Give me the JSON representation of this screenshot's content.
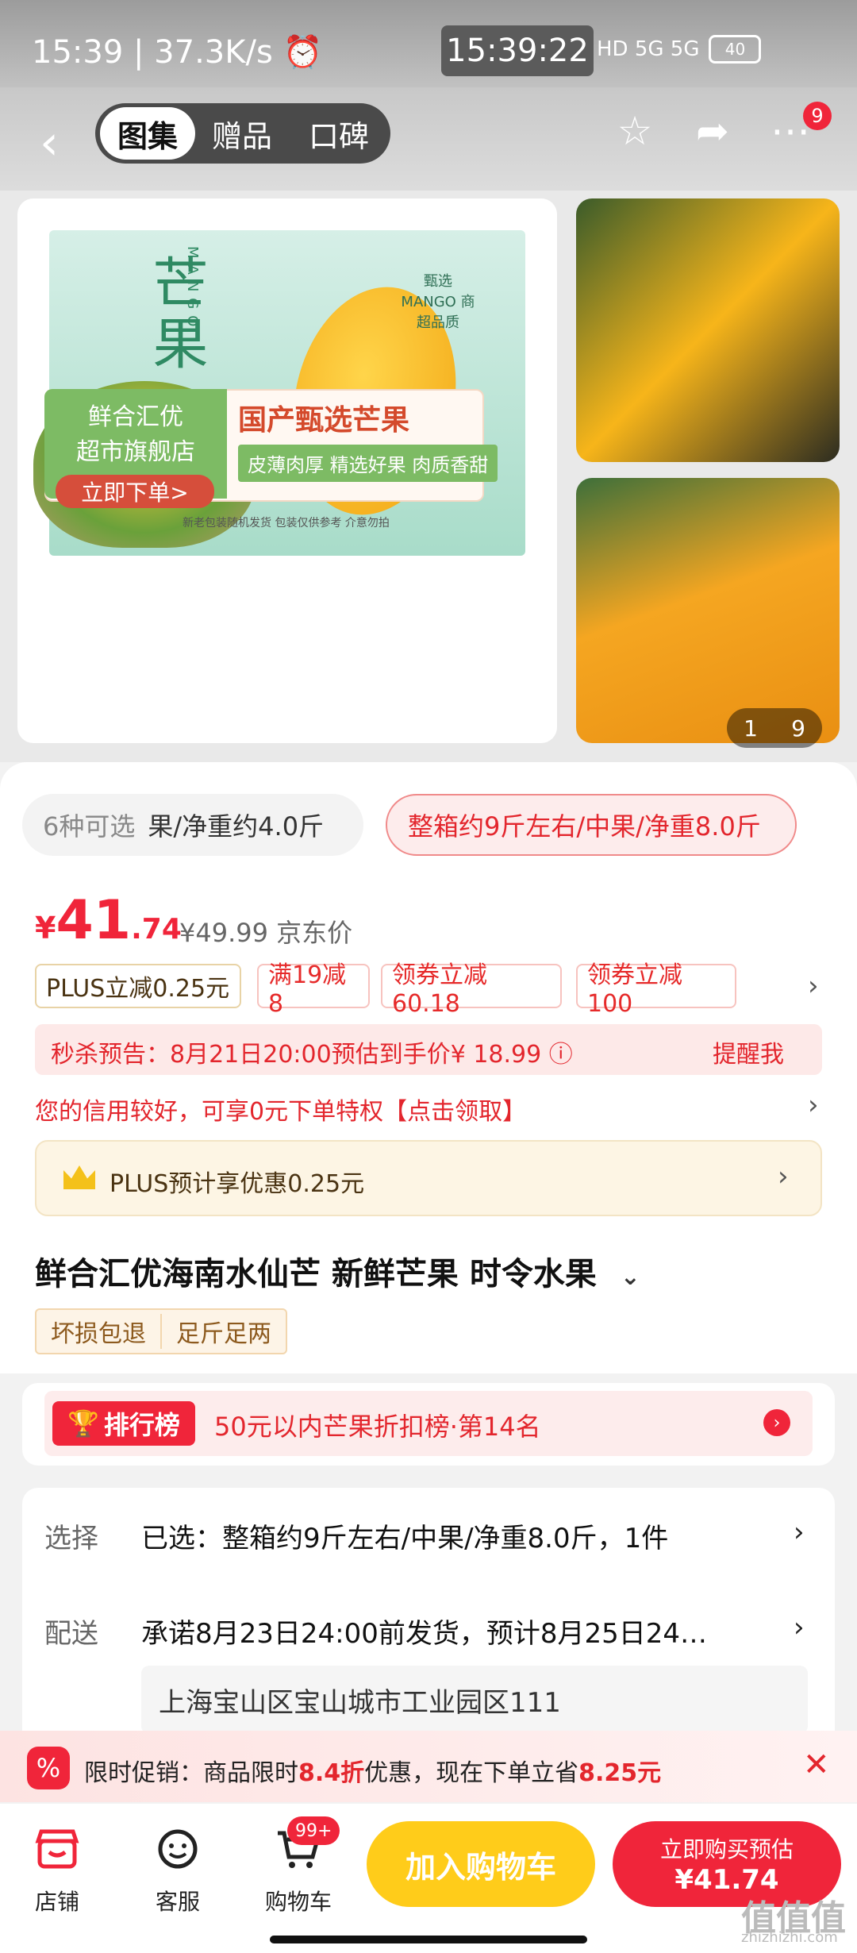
{
  "status_bar": {
    "left": "15:39 | 37.3K/s ⏰",
    "time": "15:39:22",
    "signal": "HD 5G 5G",
    "battery": "40"
  },
  "header": {
    "tabs": [
      "图集",
      "赠品",
      "口碑"
    ],
    "menu_badge": "9"
  },
  "gallery": {
    "main_title": "芒果",
    "latin": "MANGO",
    "seal": "甄选 MANGO 商超品质",
    "store_name_1": "鲜合汇优",
    "store_name_2": "超市旗舰店",
    "store_cta": "立即下单>",
    "slogan": "国产甄选芒果",
    "features": "皮薄肉厚 精选好果 肉质香甜",
    "note": "新老包装随机发货 包装仅供参考 介意勿拍",
    "pager_current": "1",
    "pager_total": "9"
  },
  "options": {
    "count_label": "6种可选",
    "option_1": "果/净重约4.0斤",
    "option_2": "整箱约9斤左右/中果/净重8.0斤"
  },
  "price": {
    "currency": "¥",
    "integer": "41",
    "decimal": ".74",
    "jd_price": "¥49.99 京东价"
  },
  "coupons": [
    "PLUS立减0.25元",
    "满19减8",
    "领券立减60.18",
    "领券立减100"
  ],
  "flash_sale": {
    "text": "秒杀预告：8月21日20:00预估到手价¥ 18.99 ⓘ",
    "button": "提醒我"
  },
  "credit_text": "您的信用较好，可享0元下单特权【点击领取】",
  "plus_text": "PLUS预计享优惠0.25元",
  "product_title": "鲜合汇优海南水仙芒 新鲜芒果 时令水果",
  "service_tags": [
    "坏损包退",
    "足斤足两"
  ],
  "ranking": {
    "label": "排行榜",
    "text": "50元以内芒果折扣榜·第14名"
  },
  "selection": {
    "select_label": "选择",
    "select_value": "已选：整箱约9斤左右/中果/净重8.0斤，1件",
    "delivery_label": "配送",
    "delivery_value": "承诺8月23日24:00前发货，预计8月25日24…",
    "address": "上海宝山区宝山城市工业园区111"
  },
  "promo": {
    "pre": "限时促销：商品限时",
    "discount": "8.4折",
    "mid": "优惠，现在下单立省",
    "save": "8.25元"
  },
  "bottom_bar": {
    "store": "店铺",
    "service": "客服",
    "cart": "购物车",
    "cart_badge": "99+",
    "add_cart": "加入购物车",
    "buy_line1": "立即购买预估",
    "buy_line2": "¥41.74"
  },
  "watermark": {
    "main": "值值值",
    "sub": "zhizhizhi.com"
  }
}
